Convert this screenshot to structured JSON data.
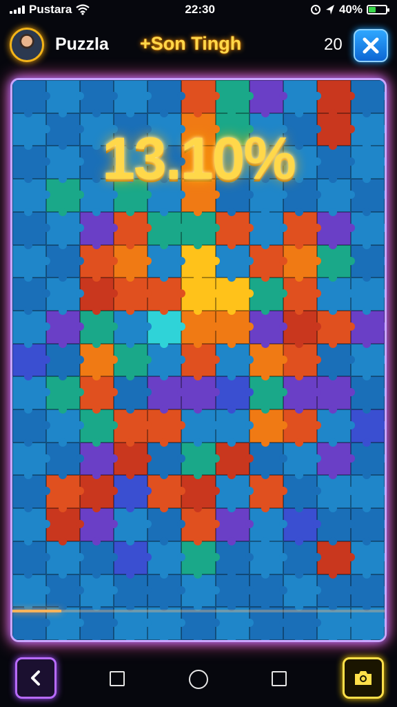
{
  "status_bar": {
    "carrier": "Pustara",
    "time": "22:30",
    "battery": "40%",
    "battery_level": 0.4
  },
  "header": {
    "player_name": "Puzzla",
    "level_title": "+Son Tingh",
    "move_count": "20"
  },
  "game": {
    "progress_text": "13.10%",
    "progress_value": 0.131,
    "columns": 11,
    "rows": 17,
    "palette": [
      "#1f86c9",
      "#1a6fb8",
      "#6a3fc6",
      "#e0501f",
      "#f07a14",
      "#1aa889",
      "#ffc21a",
      "#2fd3d8",
      "#c9371e",
      "#3a4fd1"
    ],
    "board_colors": [
      "#1a6fb8",
      "#1f86c9",
      "#1a6fb8",
      "#1f86c9",
      "#1a6fb8",
      "#e0501f",
      "#1aa889",
      "#6a3fc6",
      "#1f86c9",
      "#c9371e",
      "#1a6fb8",
      "#1f86c9",
      "#1a6fb8",
      "#1f86c9",
      "#1a6fb8",
      "#1f86c9",
      "#f07a14",
      "#1aa889",
      "#1f86c9",
      "#1a6fb8",
      "#c9371e",
      "#1f86c9",
      "#1a6fb8",
      "#1f86c9",
      "#1a6fb8",
      "#1f86c9",
      "#1a6fb8",
      "#f07a14",
      "#1f86c9",
      "#1a6fb8",
      "#1f86c9",
      "#1a6fb8",
      "#1f86c9",
      "#1f86c9",
      "#1aa889",
      "#1f86c9",
      "#1aa889",
      "#1f86c9",
      "#f07a14",
      "#1a6fb8",
      "#1f86c9",
      "#1a6fb8",
      "#1f86c9",
      "#1a6fb8",
      "#1a6fb8",
      "#1f86c9",
      "#6a3fc6",
      "#e0501f",
      "#1aa889",
      "#1aa889",
      "#e0501f",
      "#1f86c9",
      "#e0501f",
      "#6a3fc6",
      "#1f86c9",
      "#1f86c9",
      "#1a6fb8",
      "#e0501f",
      "#f07a14",
      "#1f86c9",
      "#ffc21a",
      "#1f86c9",
      "#e0501f",
      "#f07a14",
      "#1aa889",
      "#1a6fb8",
      "#1a6fb8",
      "#1f86c9",
      "#c9371e",
      "#e0501f",
      "#e0501f",
      "#ffc21a",
      "#ffc21a",
      "#1aa889",
      "#e0501f",
      "#1f86c9",
      "#1f86c9",
      "#1f86c9",
      "#6a3fc6",
      "#1aa889",
      "#1f86c9",
      "#2fd3d8",
      "#f07a14",
      "#f07a14",
      "#6a3fc6",
      "#c9371e",
      "#e0501f",
      "#6a3fc6",
      "#3a4fd1",
      "#1a6fb8",
      "#f07a14",
      "#1aa889",
      "#1f86c9",
      "#e0501f",
      "#1f86c9",
      "#f07a14",
      "#e0501f",
      "#1a6fb8",
      "#1f86c9",
      "#1f86c9",
      "#1aa889",
      "#e0501f",
      "#1a6fb8",
      "#6a3fc6",
      "#6a3fc6",
      "#3a4fd1",
      "#1aa889",
      "#6a3fc6",
      "#6a3fc6",
      "#1a6fb8",
      "#1a6fb8",
      "#1f86c9",
      "#1aa889",
      "#e0501f",
      "#e0501f",
      "#1f86c9",
      "#1f86c9",
      "#f07a14",
      "#e0501f",
      "#1f86c9",
      "#3a4fd1",
      "#1f86c9",
      "#1a6fb8",
      "#6a3fc6",
      "#c9371e",
      "#1a6fb8",
      "#1aa889",
      "#c9371e",
      "#1a6fb8",
      "#1f86c9",
      "#6a3fc6",
      "#1a6fb8",
      "#1a6fb8",
      "#e0501f",
      "#c9371e",
      "#3a4fd1",
      "#e0501f",
      "#c9371e",
      "#1f86c9",
      "#e0501f",
      "#1a6fb8",
      "#1f86c9",
      "#1f86c9",
      "#1f86c9",
      "#c9371e",
      "#6a3fc6",
      "#1f86c9",
      "#1a6fb8",
      "#e0501f",
      "#6a3fc6",
      "#1f86c9",
      "#3a4fd1",
      "#1a6fb8",
      "#1a6fb8",
      "#1a6fb8",
      "#1f86c9",
      "#1a6fb8",
      "#3a4fd1",
      "#1f86c9",
      "#1aa889",
      "#1a6fb8",
      "#1f86c9",
      "#1a6fb8",
      "#c9371e",
      "#1f86c9",
      "#1f86c9",
      "#1a6fb8",
      "#1f86c9",
      "#1a6fb8",
      "#1a6fb8",
      "#1f86c9",
      "#1a6fb8",
      "#1a6fb8",
      "#1f86c9",
      "#1a6fb8",
      "#1a6fb8",
      "#1a6fb8",
      "#1f86c9",
      "#1a6fb8",
      "#1f86c9",
      "#1f86c9",
      "#1a6fb8",
      "#1f86c9",
      "#1a6fb8",
      "#1a6fb8",
      "#1f86c9",
      "#1f86c9"
    ]
  },
  "navigation": {
    "back_icon": "chevron-left-icon",
    "recents_icon": "square-icon",
    "home_icon": "circle-icon",
    "camera_icon": "camera-icon"
  },
  "colors": {
    "accent_gold": "#ffd84a",
    "accent_purple": "#b86bff",
    "close_blue": "#1a86ff",
    "battery_green": "#39d84a"
  }
}
